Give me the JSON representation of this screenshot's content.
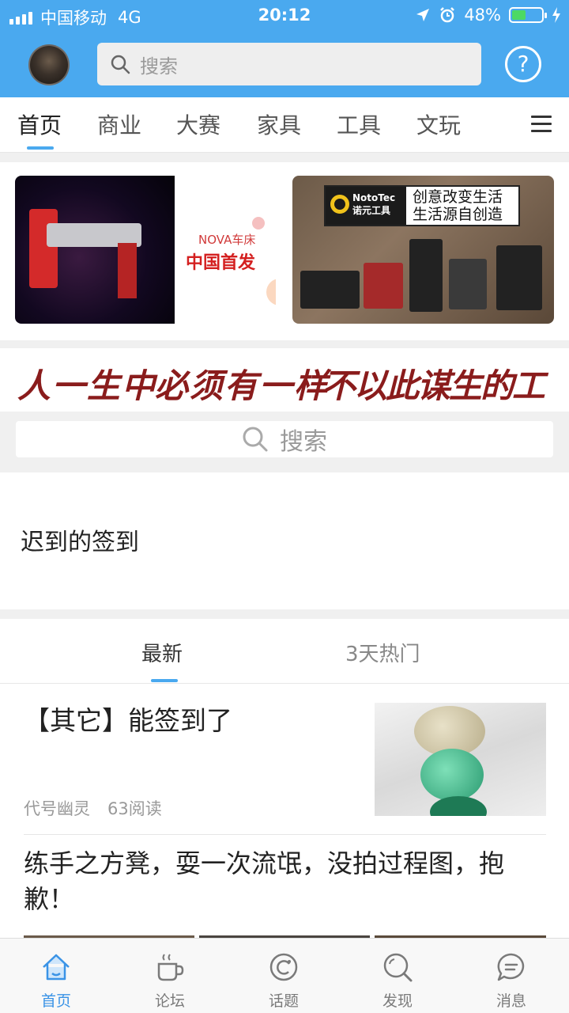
{
  "status_bar": {
    "carrier": "中国移动",
    "network": "4G",
    "time": "20:12",
    "battery": "48%",
    "battery_level": 0.48
  },
  "header": {
    "search_placeholder": "搜索",
    "help_label": "?"
  },
  "category_tabs": [
    {
      "label": "首页",
      "active": true
    },
    {
      "label": "商业",
      "active": false
    },
    {
      "label": "大赛",
      "active": false
    },
    {
      "label": "家具",
      "active": false
    },
    {
      "label": "工具",
      "active": false
    },
    {
      "label": "文玩",
      "active": false
    }
  ],
  "banners": {
    "left_brand": "NOVA车床",
    "left_headline": "中国首发",
    "right_brand_en": "NotoTec",
    "right_brand_cn": "诺元工具",
    "right_slogan_line1": "创意改变生活",
    "right_slogan_line2": "生活源自创造"
  },
  "calligraphy": {
    "part1": "人一生中",
    "part2": "必须有一样",
    "part3": "不以此谋生的工作"
  },
  "search_bar": {
    "placeholder": "搜索"
  },
  "notice": {
    "text": "迟到的签到"
  },
  "feed_tabs": [
    {
      "label": "最新",
      "active": true
    },
    {
      "label": "3天热门",
      "active": false
    }
  ],
  "posts": [
    {
      "title": "【其它】能签到了",
      "author": "代号幽灵",
      "reads": "63阅读"
    },
    {
      "title": "练手之方凳，耍一次流氓，没拍过程图，抱歉！"
    }
  ],
  "bottom_nav": [
    {
      "label": "首页",
      "icon": "home-icon",
      "active": true
    },
    {
      "label": "论坛",
      "icon": "coffee-icon",
      "active": false
    },
    {
      "label": "话题",
      "icon": "topic-icon",
      "active": false
    },
    {
      "label": "发现",
      "icon": "discover-icon",
      "active": false
    },
    {
      "label": "消息",
      "icon": "message-icon",
      "active": false
    }
  ],
  "colors": {
    "brand_blue": "#4aa9ef",
    "active_tab": "#3a93e6",
    "calligraphy_red": "#8a1c1c"
  }
}
